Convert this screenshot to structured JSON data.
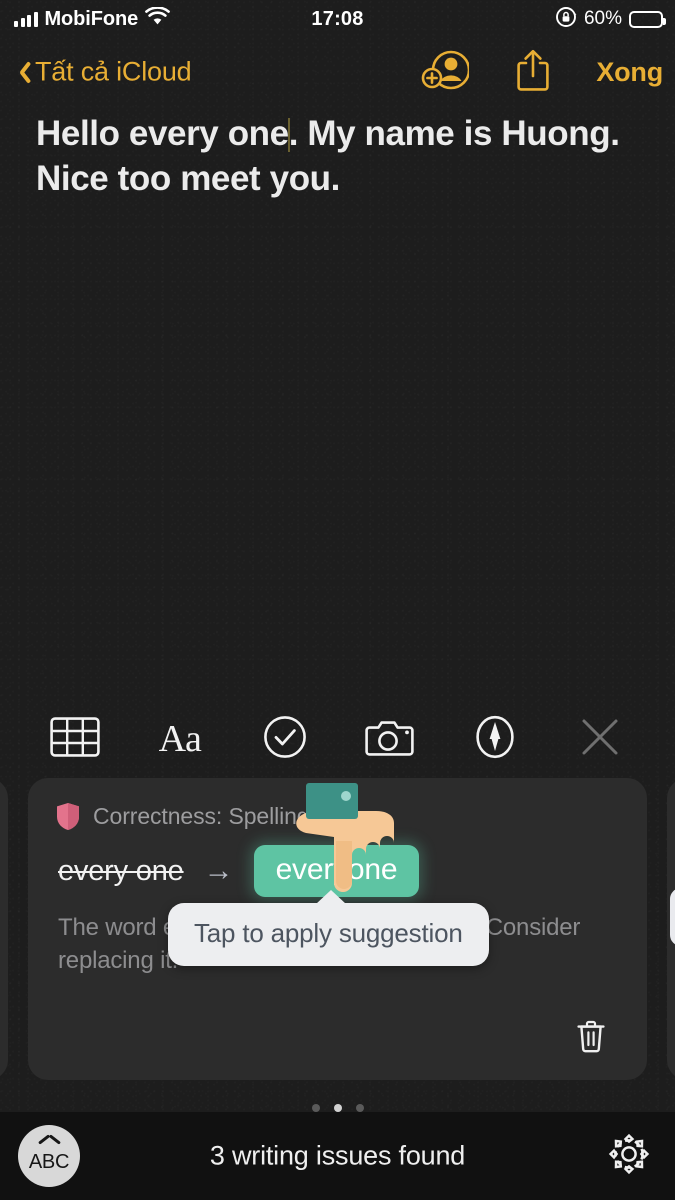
{
  "status_bar": {
    "carrier": "MobiFone",
    "signal_icon": "cellular-bars-icon",
    "wifi_icon": "wifi-icon",
    "time": "17:08",
    "rotation_lock_icon": "rotation-lock-icon",
    "battery_percent": "60%",
    "battery_icon": "battery-icon",
    "battery_level": 60
  },
  "nav_bar": {
    "back_label": "Tất cả iCloud",
    "back_icon": "chevron-left-icon",
    "add_person_icon": "add-person-icon",
    "share_icon": "share-icon",
    "done_label": "Xong",
    "accent_color": "#e8ae34"
  },
  "note": {
    "text_before_caret": "Hello every one",
    "text_after_caret": ". My name is Huong. Nice too meet you.",
    "full_text": "Hello every one. My name is Huong. Nice too meet you."
  },
  "editor_toolbar": {
    "items": [
      {
        "name": "table-icon",
        "label": "Table"
      },
      {
        "name": "text-format-icon",
        "label": "Aa"
      },
      {
        "name": "checklist-icon",
        "label": "Checklist"
      },
      {
        "name": "camera-icon",
        "label": "Camera"
      },
      {
        "name": "markup-pen-icon",
        "label": "Markup"
      },
      {
        "name": "close-icon",
        "label": "Close"
      }
    ],
    "format_label": "Aa"
  },
  "suggestion_card": {
    "shield_icon": "shield-icon",
    "shield_color": "#e3738c",
    "category": "Correctness: Spelling",
    "original_text": "every one",
    "arrow": "→",
    "replacement_text": "everyone",
    "replacement_color": "#5ec4a3",
    "description": "The word everyone is incorrectly written. Consider replacing it.",
    "delete_icon": "trash-icon"
  },
  "tooltip": {
    "text": "Tap to apply suggestion"
  },
  "cursor": {
    "icon": "pointing-hand-cursor",
    "cuff_color": "#3d9186",
    "skin_color": "#f6c896"
  },
  "pagination": {
    "total": 3,
    "active_index": 1
  },
  "bottom_bar": {
    "keyboard_label": "ABC",
    "keyboard_chevron_icon": "chevron-up-icon",
    "status_text": "3 writing issues found",
    "settings_icon": "gear-icon"
  }
}
